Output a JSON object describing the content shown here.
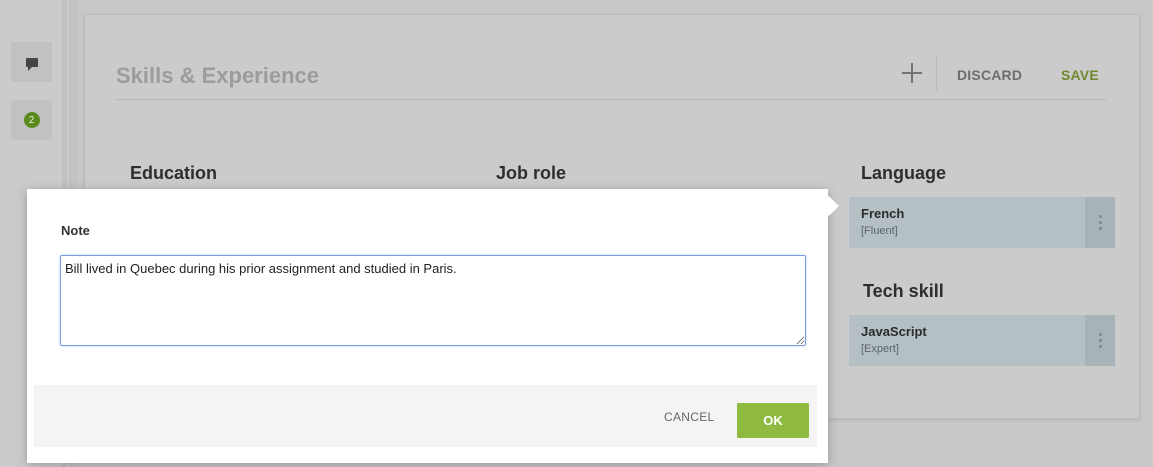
{
  "rail": {
    "comments_icon": "comment-icon",
    "badge_count": "2"
  },
  "panel": {
    "title": "Skills & Experience",
    "add_icon": "plus-icon",
    "discard_label": "DISCARD",
    "save_label": "SAVE",
    "columns": {
      "education": "Education",
      "job_role": "Job role",
      "language": "Language",
      "tech_skill": "Tech skill"
    },
    "language_items": [
      {
        "name": "French",
        "level": "[Fluent]"
      }
    ],
    "tech_items": [
      {
        "name": "JavaScript",
        "level": "[Expert]"
      }
    ]
  },
  "modal": {
    "label": "Note",
    "note_value": "Bill lived in Quebec during his prior assignment and studied in Paris.",
    "cancel_label": "CANCEL",
    "ok_label": "OK"
  },
  "colors": {
    "save_accent": "#6f8a2e",
    "ok_button": "#8ebb3f",
    "badge": "#5b8a1e",
    "focus_border": "#7a9ce0"
  }
}
